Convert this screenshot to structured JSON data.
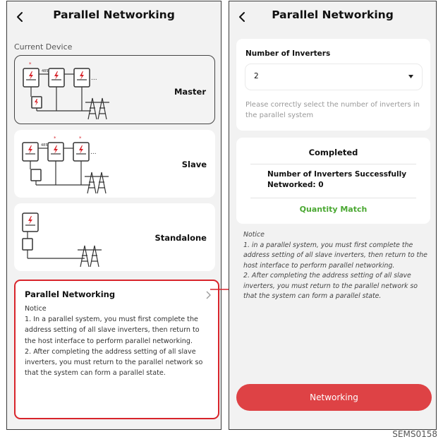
{
  "left_screen": {
    "title": "Parallel Networking",
    "section_label": "Current Device",
    "devices": [
      {
        "label": "Master",
        "selected": true
      },
      {
        "label": "Slave",
        "selected": false
      },
      {
        "label": "Standalone",
        "selected": false
      }
    ],
    "info_card": {
      "title": "Parallel Networking",
      "text": "Notice\n1. In a parallel system, you must first complete the address setting of all slave inverters, then return to the host interface to perform parallel networking.\n2. After completing the address setting of all slave inverters, you must return to the parallel network so that the system can form a parallel state."
    }
  },
  "right_screen": {
    "title": "Parallel Networking",
    "inverters_label": "Number of Inverters",
    "inverters_value": "2",
    "helper_text": "Please correctly select the number of inverters in the parallel system",
    "status_title": "Completed",
    "count_text": "Number of Inverters Successfully Networked: 0",
    "match_text": "Quantity Match",
    "notice": "Notice\n1. in a parallel system, you must first complete the address setting of all slave inverters, then return to the host interface to perform parallel networking.\n2. After completing the address setting of all slave inverters, you must return to the parallel network so that the system can form a parallel state.",
    "button_label": "Networking"
  },
  "figure_code": "SEMS0158",
  "colors": {
    "accent": "#de4245",
    "highlight_border": "#d8242b",
    "success": "#4aa832"
  }
}
